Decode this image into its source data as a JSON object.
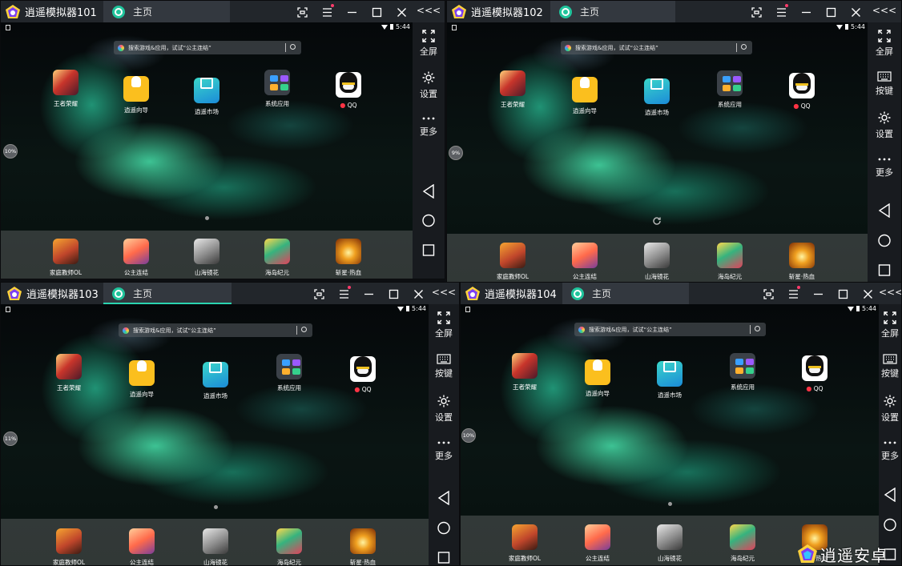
{
  "windows": [
    {
      "title": "逍遥模拟器101",
      "tab": "主页",
      "float_ball": "10%"
    },
    {
      "title": "逍遥模拟器102",
      "tab": "主页",
      "float_ball": "9%"
    },
    {
      "title": "逍遥模拟器103",
      "tab": "主页",
      "float_ball": "11%"
    },
    {
      "title": "逍遥模拟器104",
      "tab": "主页",
      "float_ball": "10%"
    }
  ],
  "status": {
    "time": "5:44"
  },
  "search": {
    "placeholder": "搜索游戏&应用，试试“公主连结”"
  },
  "home_apps": [
    {
      "label": "王者荣耀",
      "icon": "honor-of-kings-icon"
    },
    {
      "label": "逍遥向导",
      "icon": "lightbulb-icon"
    },
    {
      "label": "逍遥市场",
      "icon": "market-bag-icon"
    },
    {
      "label": "系统应用",
      "icon": "app-folder-icon"
    },
    {
      "label": "QQ",
      "icon": "qq-penguin-icon",
      "status_dot_color": "#ff3344"
    }
  ],
  "dock_apps": [
    {
      "label": "家庭教师OL",
      "icon": "home-tutor-game-icon"
    },
    {
      "label": "公主连结",
      "icon": "princess-connect-icon"
    },
    {
      "label": "山海镜花",
      "icon": "shanhai-game-icon"
    },
    {
      "label": "海岛纪元",
      "icon": "island-era-game-icon"
    },
    {
      "label": "斩星·热血",
      "icon": "zhanxing-game-icon"
    }
  ],
  "sidebar": {
    "collapse": "<<<",
    "fullscreen": "全屏",
    "keymap": "按键",
    "settings": "设置",
    "more": "更多"
  },
  "watermark": {
    "text": "逍遥安卓"
  },
  "colors": {
    "accent": "#2bd4b0",
    "notify": "#ff3b6b",
    "titlebar": "#22262b",
    "sidebar": "#181b1f"
  }
}
